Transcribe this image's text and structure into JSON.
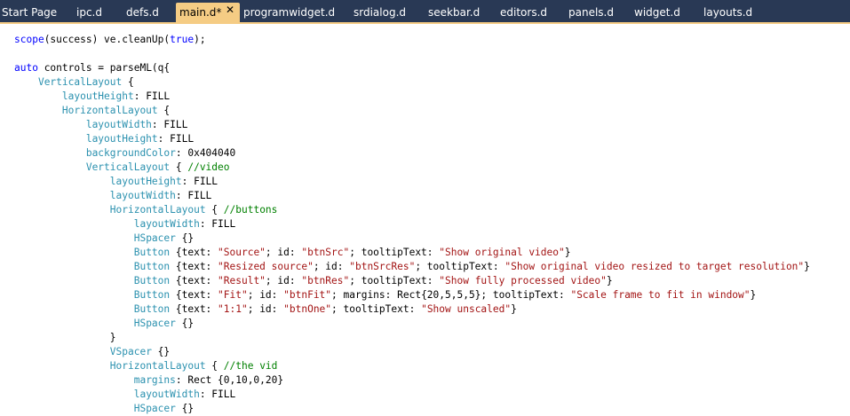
{
  "tabs": [
    {
      "label": "Start Page",
      "active": false
    },
    {
      "label": "ipc.d",
      "active": false
    },
    {
      "label": "defs.d",
      "active": false
    },
    {
      "label": "main.d*",
      "active": true
    },
    {
      "label": "programwidget.d",
      "active": false
    },
    {
      "label": "srdialog.d",
      "active": false
    },
    {
      "label": "seekbar.d",
      "active": false
    },
    {
      "label": "editors.d",
      "active": false
    },
    {
      "label": "panels.d",
      "active": false
    },
    {
      "label": "widget.d",
      "active": false
    },
    {
      "label": "layouts.d",
      "active": false
    }
  ],
  "active_tab_close_glyph": "✕",
  "colors": {
    "tab_bar": "#293955",
    "active_tab": "#f5cc84",
    "keyword": "#0000ff",
    "type": "#2b91af",
    "string": "#a31515",
    "comment": "#008000"
  },
  "code_lines": [
    [
      {
        "t": "scope",
        "k": "keyword"
      },
      {
        "t": "(success) ve.cleanUp(",
        "k": "plain"
      },
      {
        "t": "true",
        "k": "keyword"
      },
      {
        "t": ");",
        "k": "plain"
      }
    ],
    [],
    [
      {
        "t": "auto",
        "k": "keyword"
      },
      {
        "t": " controls = parseML(q{",
        "k": "plain"
      }
    ],
    [
      {
        "t": "    ",
        "k": "plain"
      },
      {
        "t": "VerticalLayout",
        "k": "type"
      },
      {
        "t": " {",
        "k": "plain"
      }
    ],
    [
      {
        "t": "        ",
        "k": "plain"
      },
      {
        "t": "layoutHeight",
        "k": "type"
      },
      {
        "t": ": FILL",
        "k": "plain"
      }
    ],
    [
      {
        "t": "        ",
        "k": "plain"
      },
      {
        "t": "HorizontalLayout",
        "k": "type"
      },
      {
        "t": " {",
        "k": "plain"
      }
    ],
    [
      {
        "t": "            ",
        "k": "plain"
      },
      {
        "t": "layoutWidth",
        "k": "type"
      },
      {
        "t": ": FILL",
        "k": "plain"
      }
    ],
    [
      {
        "t": "            ",
        "k": "plain"
      },
      {
        "t": "layoutHeight",
        "k": "type"
      },
      {
        "t": ": FILL",
        "k": "plain"
      }
    ],
    [
      {
        "t": "            ",
        "k": "plain"
      },
      {
        "t": "backgroundColor",
        "k": "type"
      },
      {
        "t": ": 0x404040",
        "k": "plain"
      }
    ],
    [
      {
        "t": "            ",
        "k": "plain"
      },
      {
        "t": "VerticalLayout",
        "k": "type"
      },
      {
        "t": " { ",
        "k": "plain"
      },
      {
        "t": "//video",
        "k": "comment"
      }
    ],
    [
      {
        "t": "                ",
        "k": "plain"
      },
      {
        "t": "layoutHeight",
        "k": "type"
      },
      {
        "t": ": FILL",
        "k": "plain"
      }
    ],
    [
      {
        "t": "                ",
        "k": "plain"
      },
      {
        "t": "layoutWidth",
        "k": "type"
      },
      {
        "t": ": FILL",
        "k": "plain"
      }
    ],
    [
      {
        "t": "                ",
        "k": "plain"
      },
      {
        "t": "HorizontalLayout",
        "k": "type"
      },
      {
        "t": " { ",
        "k": "plain"
      },
      {
        "t": "//buttons",
        "k": "comment"
      }
    ],
    [
      {
        "t": "                    ",
        "k": "plain"
      },
      {
        "t": "layoutWidth",
        "k": "type"
      },
      {
        "t": ": FILL",
        "k": "plain"
      }
    ],
    [
      {
        "t": "                    ",
        "k": "plain"
      },
      {
        "t": "HSpacer",
        "k": "type"
      },
      {
        "t": " {}",
        "k": "plain"
      }
    ],
    [
      {
        "t": "                    ",
        "k": "plain"
      },
      {
        "t": "Button",
        "k": "type"
      },
      {
        "t": " {text: ",
        "k": "plain"
      },
      {
        "t": "\"Source\"",
        "k": "string"
      },
      {
        "t": "; id: ",
        "k": "plain"
      },
      {
        "t": "\"btnSrc\"",
        "k": "string"
      },
      {
        "t": "; tooltipText: ",
        "k": "plain"
      },
      {
        "t": "\"Show original video\"",
        "k": "string"
      },
      {
        "t": "}",
        "k": "plain"
      }
    ],
    [
      {
        "t": "                    ",
        "k": "plain"
      },
      {
        "t": "Button",
        "k": "type"
      },
      {
        "t": " {text: ",
        "k": "plain"
      },
      {
        "t": "\"Resized source\"",
        "k": "string"
      },
      {
        "t": "; id: ",
        "k": "plain"
      },
      {
        "t": "\"btnSrcRes\"",
        "k": "string"
      },
      {
        "t": "; tooltipText: ",
        "k": "plain"
      },
      {
        "t": "\"Show original video resized to target resolution\"",
        "k": "string"
      },
      {
        "t": "}",
        "k": "plain"
      }
    ],
    [
      {
        "t": "                    ",
        "k": "plain"
      },
      {
        "t": "Button",
        "k": "type"
      },
      {
        "t": " {text: ",
        "k": "plain"
      },
      {
        "t": "\"Result\"",
        "k": "string"
      },
      {
        "t": "; id: ",
        "k": "plain"
      },
      {
        "t": "\"btnRes\"",
        "k": "string"
      },
      {
        "t": "; tooltipText: ",
        "k": "plain"
      },
      {
        "t": "\"Show fully processed video\"",
        "k": "string"
      },
      {
        "t": "}",
        "k": "plain"
      }
    ],
    [
      {
        "t": "                    ",
        "k": "plain"
      },
      {
        "t": "Button",
        "k": "type"
      },
      {
        "t": " {text: ",
        "k": "plain"
      },
      {
        "t": "\"Fit\"",
        "k": "string"
      },
      {
        "t": "; id: ",
        "k": "plain"
      },
      {
        "t": "\"btnFit\"",
        "k": "string"
      },
      {
        "t": "; margins: Rect{20,5,5,5}; tooltipText: ",
        "k": "plain"
      },
      {
        "t": "\"Scale frame to fit in window\"",
        "k": "string"
      },
      {
        "t": "}",
        "k": "plain"
      }
    ],
    [
      {
        "t": "                    ",
        "k": "plain"
      },
      {
        "t": "Button",
        "k": "type"
      },
      {
        "t": " {text: ",
        "k": "plain"
      },
      {
        "t": "\"1:1\"",
        "k": "string"
      },
      {
        "t": "; id: ",
        "k": "plain"
      },
      {
        "t": "\"btnOne\"",
        "k": "string"
      },
      {
        "t": "; tooltipText: ",
        "k": "plain"
      },
      {
        "t": "\"Show unscaled\"",
        "k": "string"
      },
      {
        "t": "}",
        "k": "plain"
      }
    ],
    [
      {
        "t": "                    ",
        "k": "plain"
      },
      {
        "t": "HSpacer",
        "k": "type"
      },
      {
        "t": " {}",
        "k": "plain"
      }
    ],
    [
      {
        "t": "                }",
        "k": "plain"
      }
    ],
    [
      {
        "t": "                ",
        "k": "plain"
      },
      {
        "t": "VSpacer",
        "k": "type"
      },
      {
        "t": " {}",
        "k": "plain"
      }
    ],
    [
      {
        "t": "                ",
        "k": "plain"
      },
      {
        "t": "HorizontalLayout",
        "k": "type"
      },
      {
        "t": " { ",
        "k": "plain"
      },
      {
        "t": "//the vid",
        "k": "comment"
      }
    ],
    [
      {
        "t": "                    ",
        "k": "plain"
      },
      {
        "t": "margins",
        "k": "type"
      },
      {
        "t": ": Rect {0,10,0,20}",
        "k": "plain"
      }
    ],
    [
      {
        "t": "                    ",
        "k": "plain"
      },
      {
        "t": "layoutWidth",
        "k": "type"
      },
      {
        "t": ": FILL",
        "k": "plain"
      }
    ],
    [
      {
        "t": "                    ",
        "k": "plain"
      },
      {
        "t": "HSpacer",
        "k": "type"
      },
      {
        "t": " {}",
        "k": "plain"
      }
    ]
  ]
}
